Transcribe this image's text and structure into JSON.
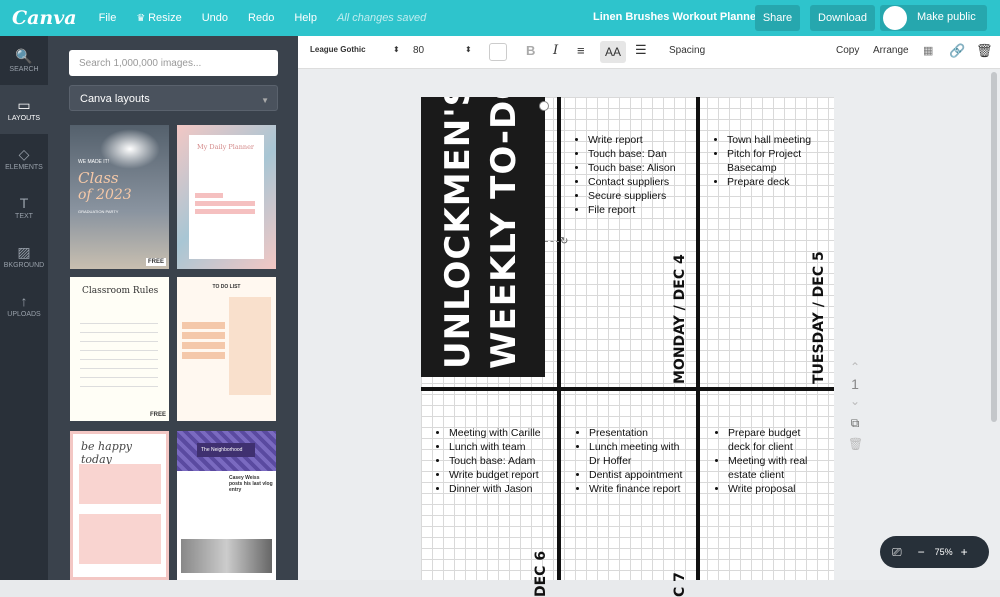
{
  "topbar": {
    "logo": "Canva",
    "menu": [
      "File",
      "Resize",
      "Undo",
      "Redo",
      "Help"
    ],
    "saved": "All changes saved",
    "title": "Linen Brushes Workout Planner",
    "share": "Share",
    "download": "Download",
    "make_public": "Make public"
  },
  "sidebar": {
    "items": [
      {
        "label": "SEARCH",
        "icon": "🔍"
      },
      {
        "label": "LAYOUTS",
        "icon": "▭"
      },
      {
        "label": "ELEMENTS",
        "icon": "◇"
      },
      {
        "label": "TEXT",
        "icon": "T"
      },
      {
        "label": "BKGROUND",
        "icon": "▨"
      },
      {
        "label": "UPLOADS",
        "icon": "↑"
      }
    ]
  },
  "panel": {
    "search_placeholder": "Search 1,000,000 images...",
    "dropdown": "Canva layouts",
    "free_label": "FREE",
    "t1": {
      "a": "WE MADE IT!",
      "b": "Class",
      "c": "of 2023",
      "d": "GRADUATION PARTY"
    },
    "t2": {
      "a": "My Daily Planner"
    },
    "t3": {
      "a": "Classroom Rules"
    },
    "t4": {
      "a": "TO DO LIST"
    },
    "t5": {
      "a": "be happy today"
    },
    "t6": {
      "a": "The Neighborhood",
      "b": "Casey Weiss posts his last vlog entry"
    }
  },
  "toolbar": {
    "font": "League Gothic",
    "size": "80",
    "spacing": "Spacing",
    "copy": "Copy",
    "arrange": "Arrange"
  },
  "page": {
    "title_line1": "UNLOCKMEN'S",
    "title_line2": "WEEKLY TO-DOS",
    "mon_list": [
      "Write report",
      "Touch base: Dan",
      "Touch base: Alison",
      "Contact suppliers",
      "Secure suppliers",
      "File report"
    ],
    "tue_list": [
      "Town hall meeting",
      "Pitch for Project Basecamp",
      "Prepare deck"
    ],
    "mon_label": "MONDAY / DEC 4",
    "tue_label": "TUESDAY / DEC 5",
    "row2_a": [
      "Meeting with Carille",
      "Lunch with team",
      "Touch base: Adam",
      "Write budget report",
      "Dinner with Jason"
    ],
    "row2_b": [
      "Presentation",
      "Lunch meeting with Dr Hoffer",
      "Dentist appointment",
      "Write finance report"
    ],
    "row2_c": [
      "Prepare budget deck for client",
      "Meeting with real estate client",
      "Write proposal"
    ],
    "wed_label": "DEC 6",
    "thu_label": "C 7"
  },
  "page_num": "1",
  "zoom": "75%"
}
